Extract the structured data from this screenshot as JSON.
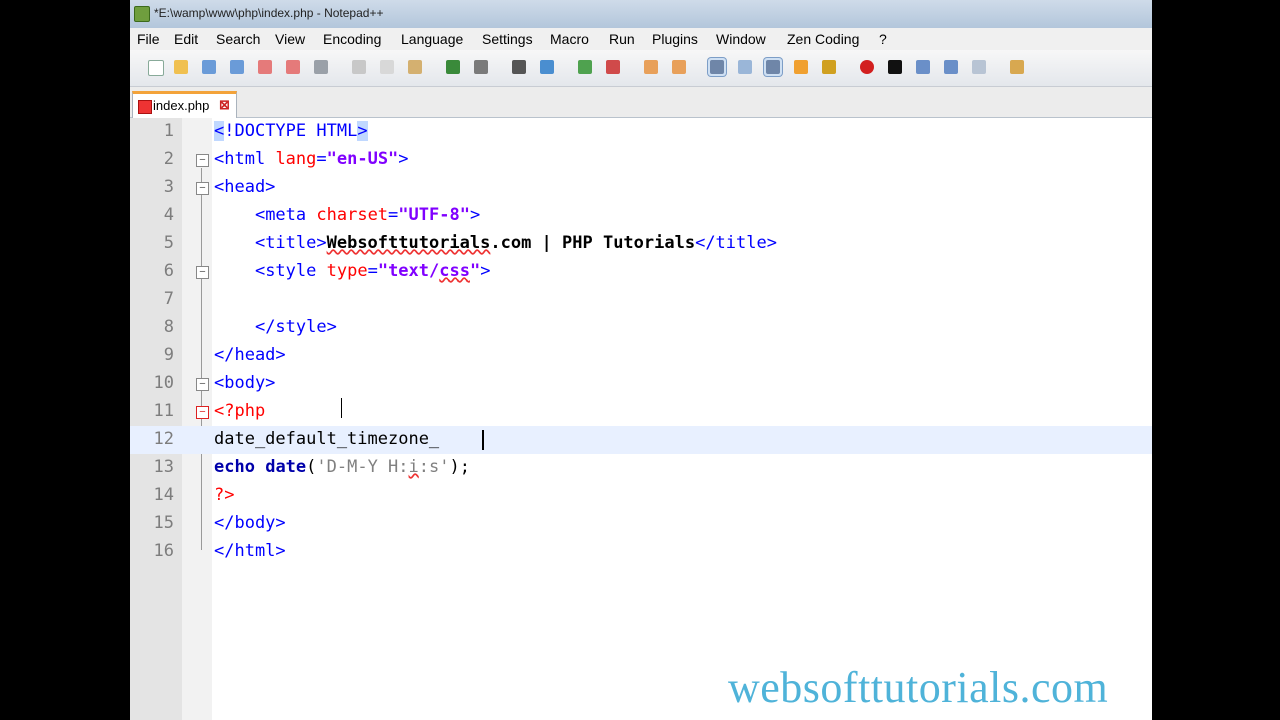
{
  "window": {
    "title": "*E:\\wamp\\www\\php\\index.php - Notepad++"
  },
  "menu": [
    "File",
    "Edit",
    "Search",
    "View",
    "Encoding",
    "Language",
    "Settings",
    "Macro",
    "Run",
    "Plugins",
    "Window",
    "Zen Coding",
    "?"
  ],
  "tab": {
    "label": "index.php"
  },
  "watermark": "websofttutorials.com"
}
